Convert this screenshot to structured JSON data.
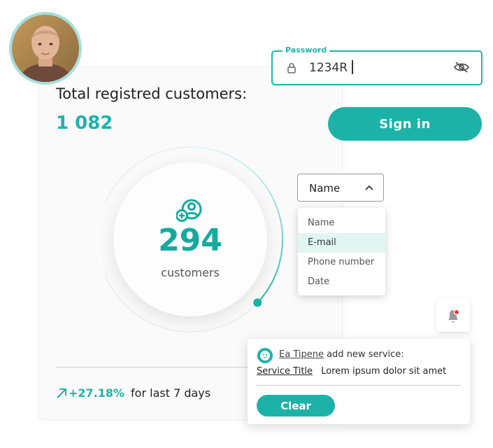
{
  "stats": {
    "total_label": "Total registred customers:",
    "total_value": "1 082",
    "customers_count": "294",
    "customers_label": "customers",
    "progress_fraction": 0.37,
    "growth_value": "+27.18%",
    "growth_label": "for last 7 days"
  },
  "password": {
    "label": "Password",
    "value": "1234R"
  },
  "signin": {
    "label": "Sign in"
  },
  "select": {
    "value": "Name",
    "options": [
      "Name",
      "E-mail",
      "Phone number",
      "Date"
    ],
    "highlighted": "E-mail"
  },
  "notification": {
    "user": "Ea Tipene",
    "action": "add new service:",
    "service_title": "Service Title",
    "service_text": "Lorem ipsum dolor sit amet",
    "clear_label": "Clear"
  },
  "colors": {
    "accent": "#1db2a8",
    "highlight": "#e1f5f1",
    "alert": "#e53935"
  },
  "icons": [
    "lock-icon",
    "eye-off-icon",
    "chevron-up-icon",
    "add-user-icon",
    "arrow-up-right-icon",
    "bell-icon",
    "smiley-icon"
  ]
}
